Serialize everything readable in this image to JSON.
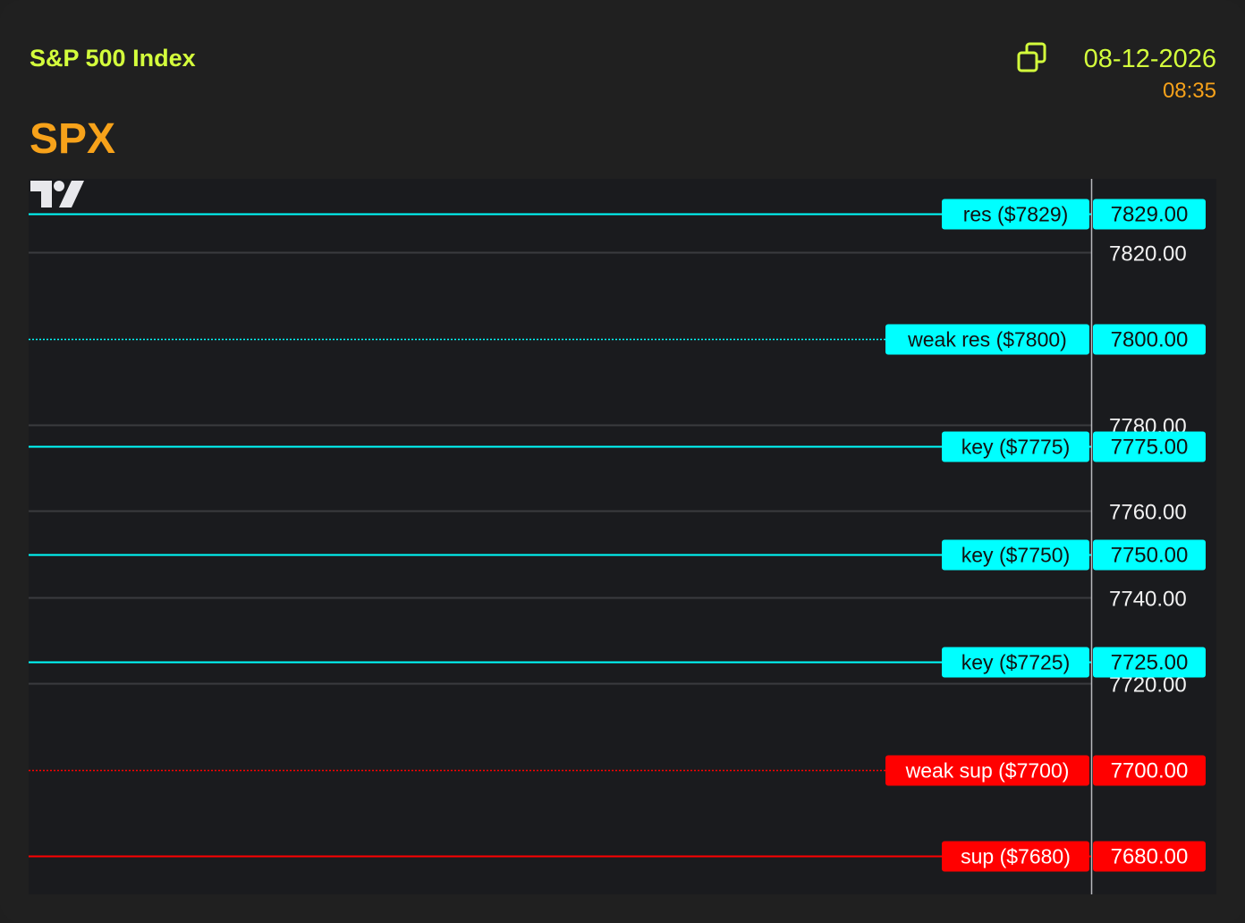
{
  "header": {
    "index_name": "S&P 500 Index",
    "date": "08-12-2026",
    "time": "08:35",
    "ticker": "SPX",
    "copy_icon": "copy-icon"
  },
  "colors": {
    "lime": "#d4ff3c",
    "orange": "#f7a21a",
    "cyan": "#00ffff",
    "red": "#ff0000",
    "grid": "#3a3b3f"
  },
  "chart_data": {
    "type": "line",
    "title": "",
    "ylabel": "",
    "xlabel": "",
    "ylim": [
      7675,
      7833
    ],
    "grid_ticks": [
      "7820.00",
      "7780.00",
      "7760.00",
      "7740.00",
      "7720.00"
    ],
    "grid_values": [
      7820,
      7780,
      7760,
      7740,
      7720
    ],
    "levels": [
      {
        "label": "res ($7829)",
        "price": "7829.00",
        "value": 7829,
        "kind": "resistance",
        "style": "solid"
      },
      {
        "label": "weak res ($7800)",
        "price": "7800.00",
        "value": 7800,
        "kind": "resistance",
        "style": "dotted"
      },
      {
        "label": "key ($7775)",
        "price": "7775.00",
        "value": 7775,
        "kind": "key",
        "style": "solid"
      },
      {
        "label": "key ($7750)",
        "price": "7750.00",
        "value": 7750,
        "kind": "key",
        "style": "solid"
      },
      {
        "label": "key ($7725)",
        "price": "7725.00",
        "value": 7725,
        "kind": "key",
        "style": "solid"
      },
      {
        "label": "weak sup ($7700)",
        "price": "7700.00",
        "value": 7700,
        "kind": "support",
        "style": "dotted"
      },
      {
        "label": "sup ($7680)",
        "price": "7680.00",
        "value": 7680,
        "kind": "support",
        "style": "solid"
      }
    ]
  }
}
